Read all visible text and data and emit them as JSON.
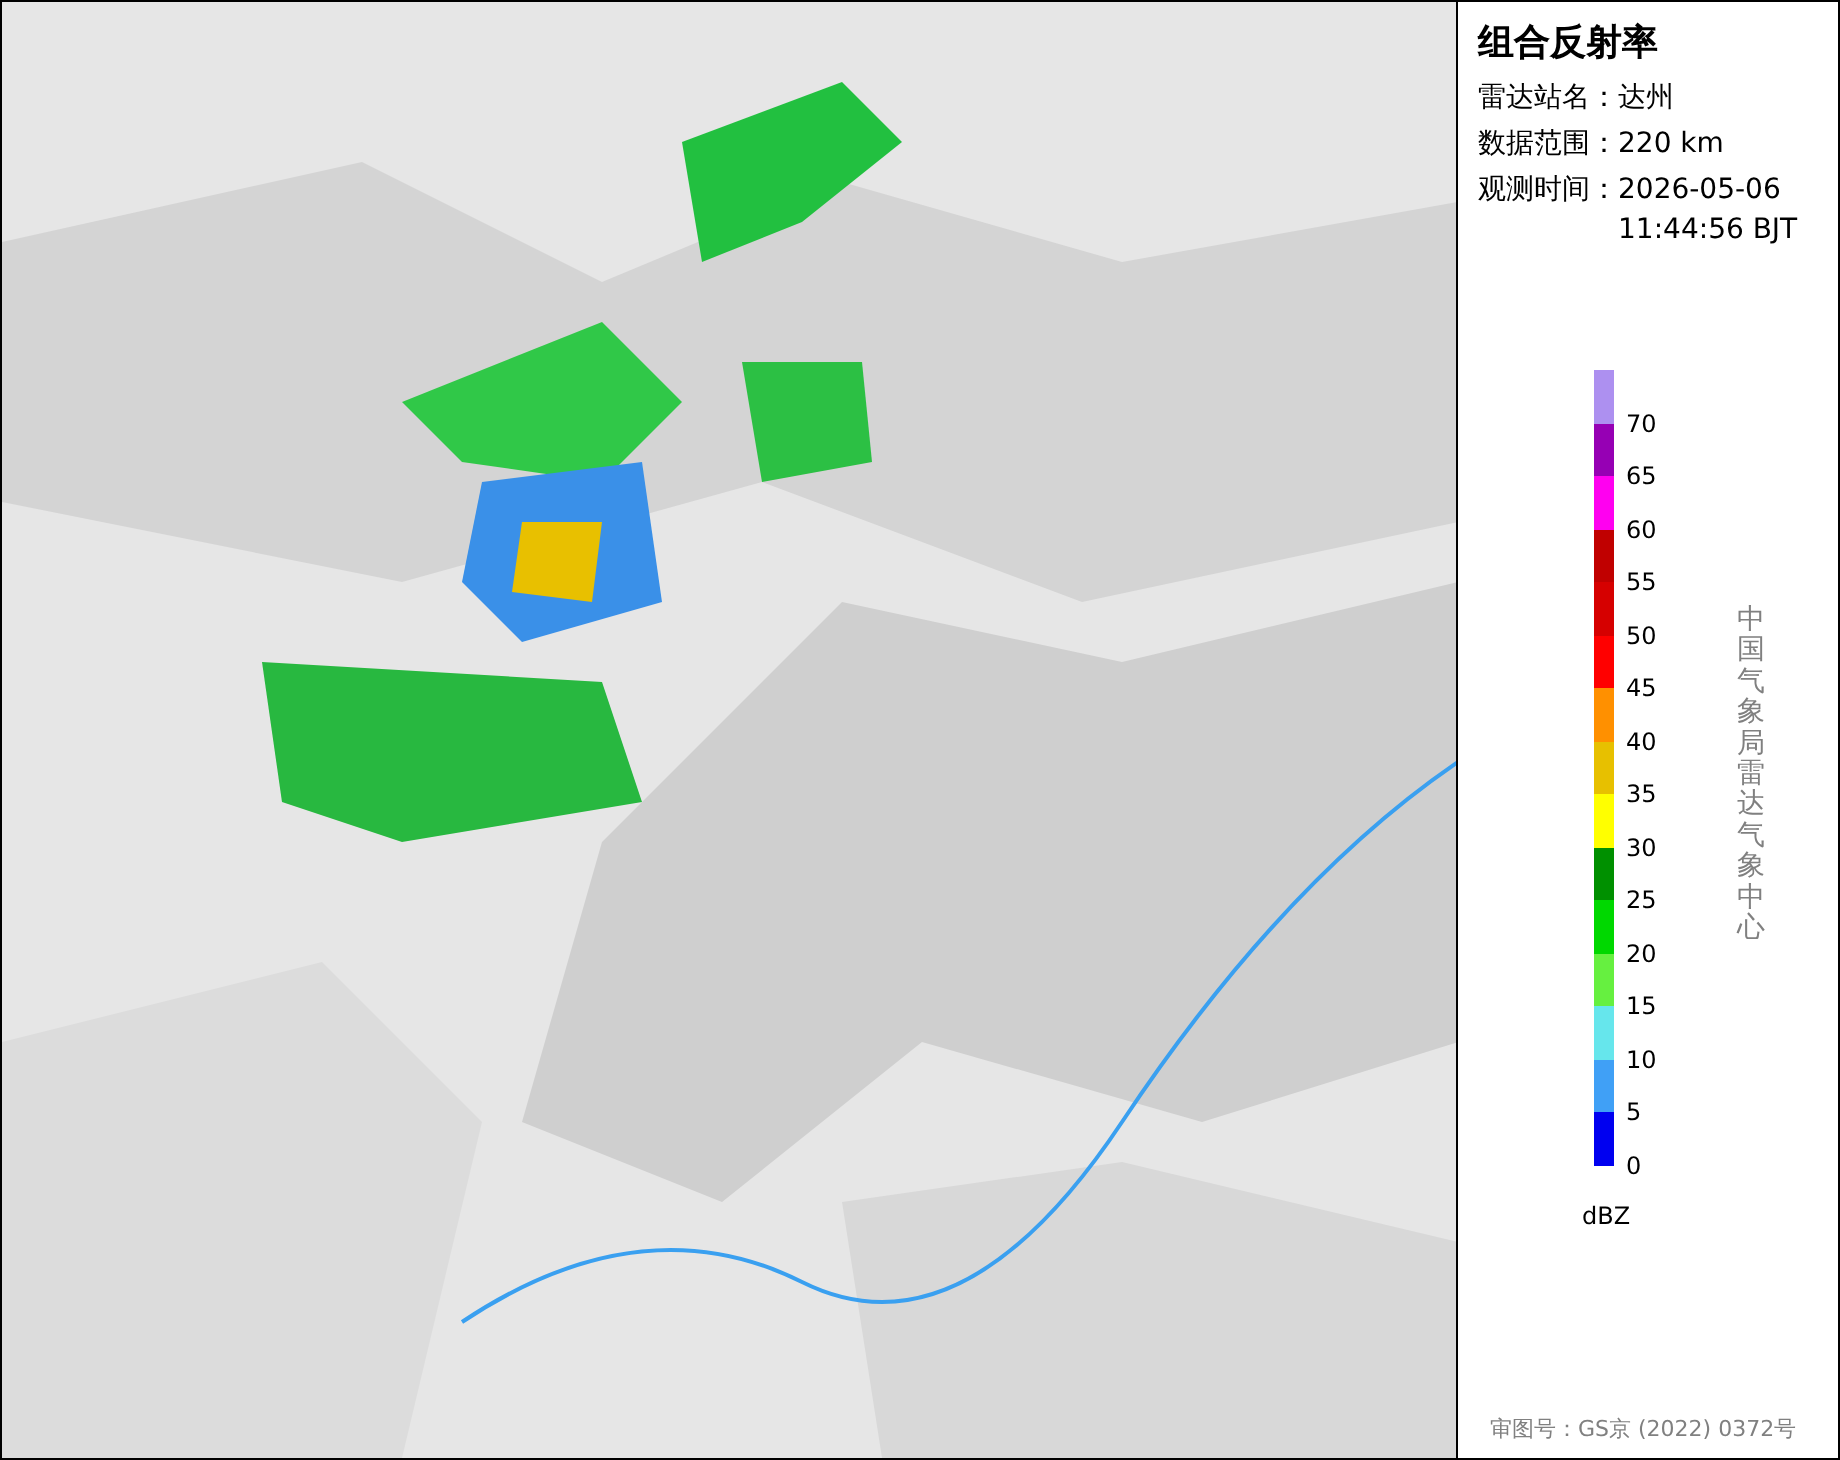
{
  "title": "组合反射率",
  "info": [
    {
      "label": "雷达站名：",
      "value": "达州"
    },
    {
      "label": "数据范围：",
      "value": "220 km"
    },
    {
      "label": "观测时间：",
      "value": "2026-05-06\n11:44:56 BJT"
    }
  ],
  "legend": {
    "bins": [
      {
        "label": "70",
        "color": "#ad90f0"
      },
      {
        "label": "65",
        "color": "#9600b4"
      },
      {
        "label": "60",
        "color": "#ff00f0"
      },
      {
        "label": "55",
        "color": "#c00000"
      },
      {
        "label": "50",
        "color": "#d60000"
      },
      {
        "label": "45",
        "color": "#ff0000"
      },
      {
        "label": "40",
        "color": "#ff9000"
      },
      {
        "label": "35",
        "color": "#e7c000"
      },
      {
        "label": "30",
        "color": "#ffff00"
      },
      {
        "label": "25",
        "color": "#009000"
      },
      {
        "label": "20",
        "color": "#00d800"
      },
      {
        "label": "15",
        "color": "#66f040"
      },
      {
        "label": "10",
        "color": "#66e6ec"
      },
      {
        "label": "5",
        "color": "#40a0f6"
      },
      {
        "label": "0",
        "color": "#0000f0"
      }
    ],
    "unit": "dBZ"
  },
  "source": "中国气象局雷达气象中心",
  "approval": "审图号：GS京 (2022) 0372号"
}
